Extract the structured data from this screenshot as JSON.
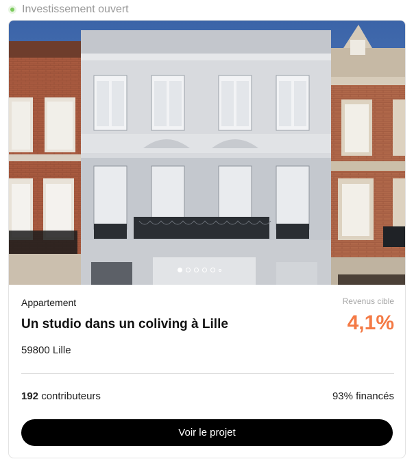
{
  "status": {
    "label": "Investissement ouvert",
    "color": "#7ccb5d"
  },
  "listing": {
    "type": "Appartement",
    "title": "Un studio dans un coliving à Lille",
    "location": "59800 Lille",
    "target_label": "Revenus cible",
    "target_rate": "4,1%",
    "rate_color": "#f47a45",
    "contributors_count": "192",
    "contributors_label": " contributeurs",
    "funded": "93% financés"
  },
  "carousel": {
    "total": 6,
    "active_index": 0
  },
  "cta": {
    "label": "Voir le projet"
  }
}
